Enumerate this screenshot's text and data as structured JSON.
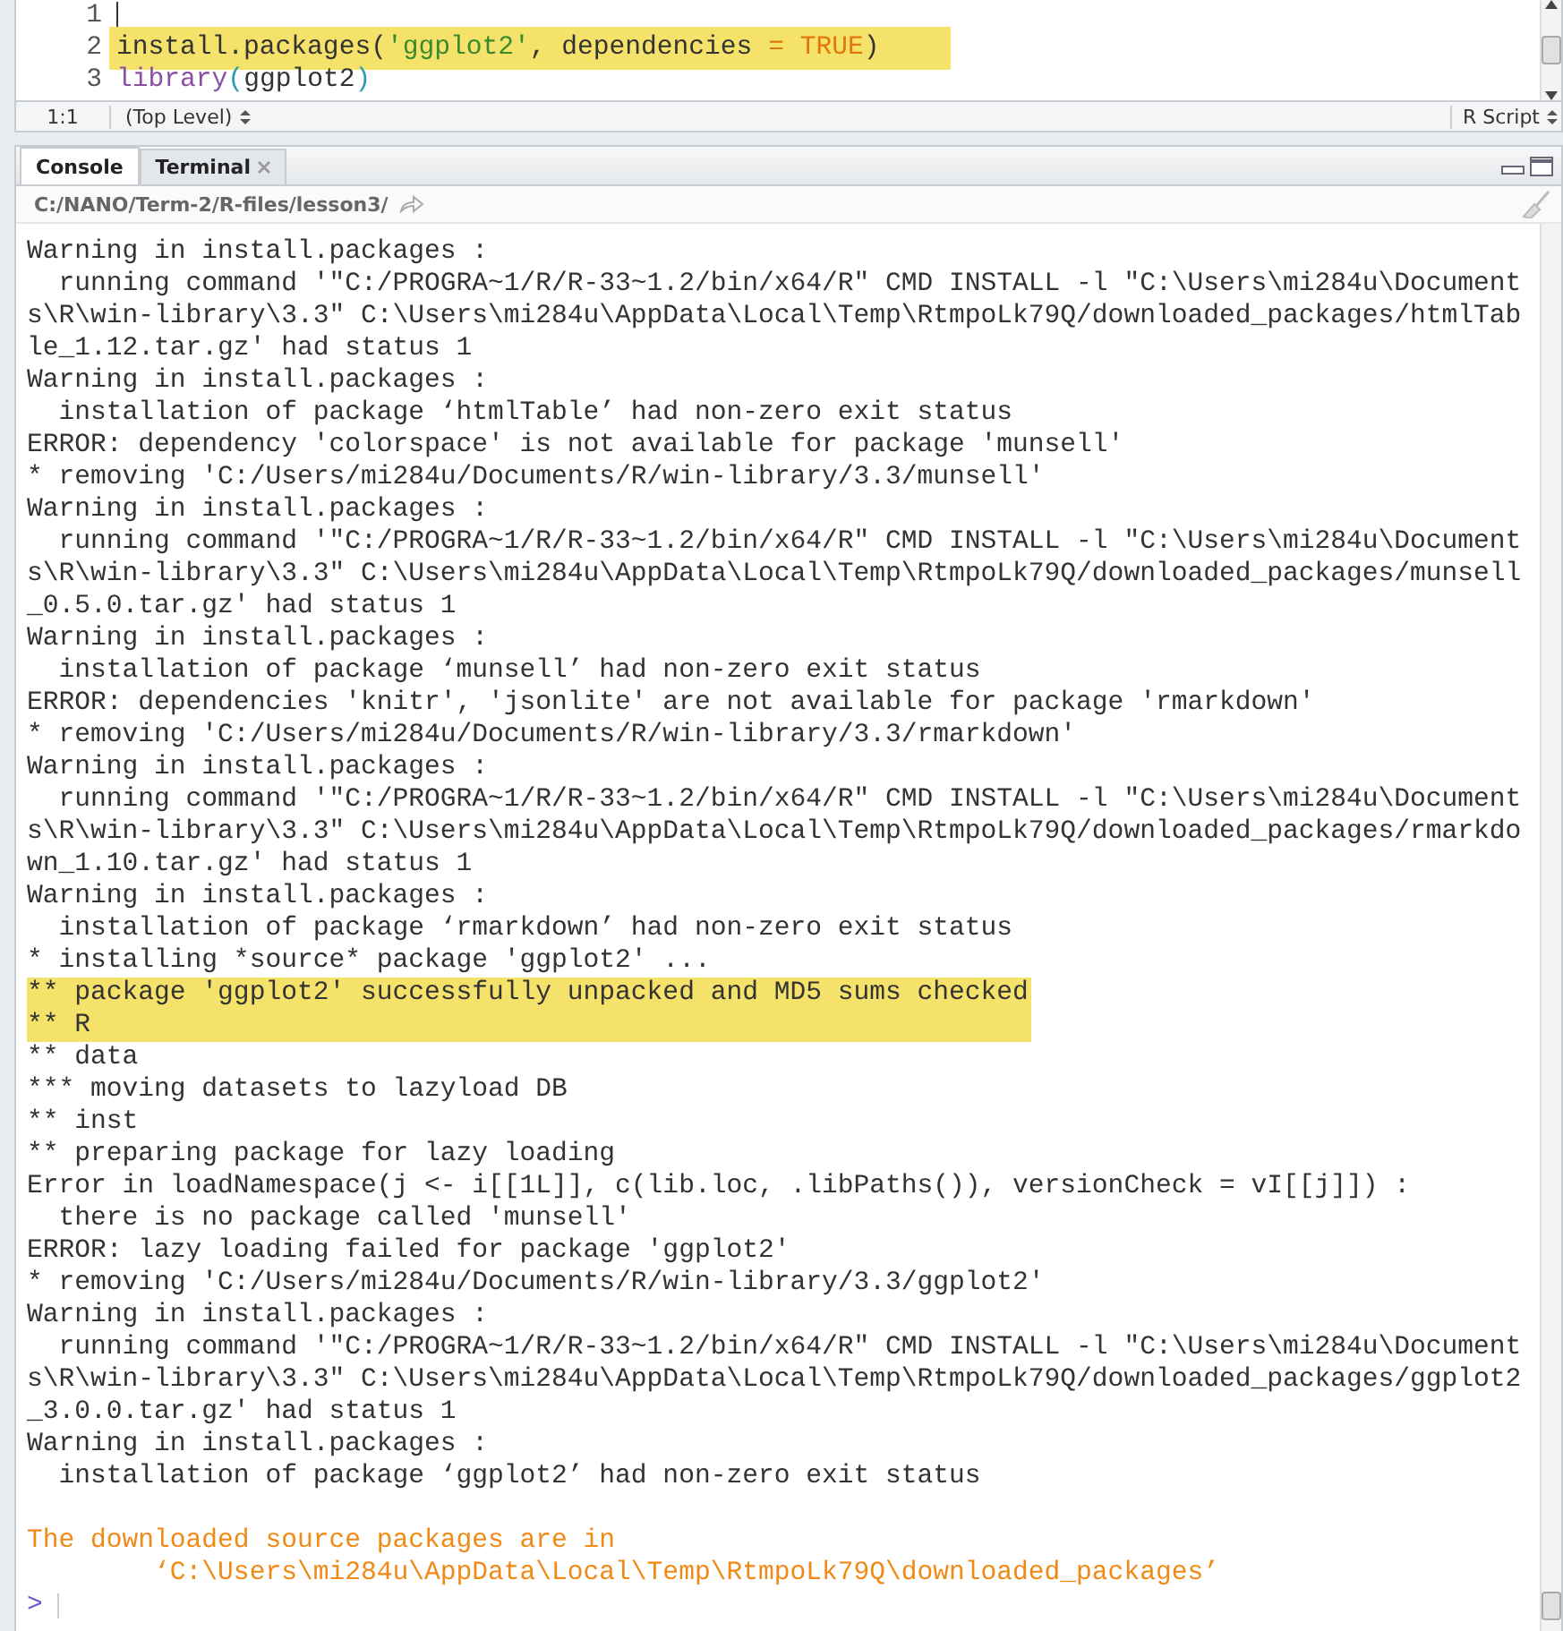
{
  "editor": {
    "lines": [
      {
        "number": "1",
        "highlighted": false,
        "cursor": true
      },
      {
        "number": "2",
        "highlighted": true,
        "cursor": false,
        "tokens": [
          {
            "kind": "plain",
            "text": "install.packages("
          },
          {
            "kind": "string",
            "text": "'ggplot2'"
          },
          {
            "kind": "plain",
            "text": ", dependencies "
          },
          {
            "kind": "operator",
            "text": "= "
          },
          {
            "kind": "constant",
            "text": "TRUE"
          },
          {
            "kind": "plain",
            "text": ")"
          }
        ]
      },
      {
        "number": "3",
        "highlighted": false,
        "cursor": false,
        "tokens": [
          {
            "kind": "function",
            "text": "library"
          },
          {
            "kind": "paren",
            "text": "("
          },
          {
            "kind": "plain",
            "text": "ggplot2"
          },
          {
            "kind": "paren",
            "text": ")"
          }
        ]
      }
    ]
  },
  "status_bar": {
    "position": "1:1",
    "scope": "(Top Level)",
    "file_type": "R Script"
  },
  "console_pane": {
    "tabs": [
      {
        "label": "Console",
        "selected": true,
        "closable": false
      },
      {
        "label": "Terminal",
        "selected": false,
        "closable": true
      }
    ],
    "path": "C:/NANO/Term-2/R-files/lesson3/",
    "lines": [
      {
        "kind": "output",
        "text": "Warning in install.packages :"
      },
      {
        "kind": "output",
        "text": "  running command '\"C:/PROGRA~1/R/R-33~1.2/bin/x64/R\" CMD INSTALL -l \"C:\\Users\\mi284u\\Document"
      },
      {
        "kind": "output",
        "text": "s\\R\\win-library\\3.3\" C:\\Users\\mi284u\\AppData\\Local\\Temp\\RtmpoLk79Q/downloaded_packages/htmlTab"
      },
      {
        "kind": "output",
        "text": "le_1.12.tar.gz' had status 1"
      },
      {
        "kind": "output",
        "text": "Warning in install.packages :"
      },
      {
        "kind": "output",
        "text": "  installation of package ‘htmlTable’ had non-zero exit status"
      },
      {
        "kind": "output",
        "text": "ERROR: dependency 'colorspace' is not available for package 'munsell'"
      },
      {
        "kind": "output",
        "text": "* removing 'C:/Users/mi284u/Documents/R/win-library/3.3/munsell'"
      },
      {
        "kind": "output",
        "text": "Warning in install.packages :"
      },
      {
        "kind": "output",
        "text": "  running command '\"C:/PROGRA~1/R/R-33~1.2/bin/x64/R\" CMD INSTALL -l \"C:\\Users\\mi284u\\Document"
      },
      {
        "kind": "output",
        "text": "s\\R\\win-library\\3.3\" C:\\Users\\mi284u\\AppData\\Local\\Temp\\RtmpoLk79Q/downloaded_packages/munsell"
      },
      {
        "kind": "output",
        "text": "_0.5.0.tar.gz' had status 1"
      },
      {
        "kind": "output",
        "text": "Warning in install.packages :"
      },
      {
        "kind": "output",
        "text": "  installation of package ‘munsell’ had non-zero exit status"
      },
      {
        "kind": "output",
        "text": "ERROR: dependencies 'knitr', 'jsonlite' are not available for package 'rmarkdown'"
      },
      {
        "kind": "output",
        "text": "* removing 'C:/Users/mi284u/Documents/R/win-library/3.3/rmarkdown'"
      },
      {
        "kind": "output",
        "text": "Warning in install.packages :"
      },
      {
        "kind": "output",
        "text": "  running command '\"C:/PROGRA~1/R/R-33~1.2/bin/x64/R\" CMD INSTALL -l \"C:\\Users\\mi284u\\Document"
      },
      {
        "kind": "output",
        "text": "s\\R\\win-library\\3.3\" C:\\Users\\mi284u\\AppData\\Local\\Temp\\RtmpoLk79Q/downloaded_packages/rmarkdo"
      },
      {
        "kind": "output",
        "text": "wn_1.10.tar.gz' had status 1"
      },
      {
        "kind": "output",
        "text": "Warning in install.packages :"
      },
      {
        "kind": "output",
        "text": "  installation of package ‘rmarkdown’ had non-zero exit status"
      },
      {
        "kind": "output",
        "text": "* installing *source* package 'ggplot2' ..."
      },
      {
        "kind": "highlight",
        "text": "** package 'ggplot2' successfully unpacked and MD5 sums checked"
      },
      {
        "kind": "highlight",
        "text": "** R"
      },
      {
        "kind": "output",
        "text": "** data"
      },
      {
        "kind": "output",
        "text": "*** moving datasets to lazyload DB"
      },
      {
        "kind": "output",
        "text": "** inst"
      },
      {
        "kind": "output",
        "text": "** preparing package for lazy loading"
      },
      {
        "kind": "output",
        "text": "Error in loadNamespace(j <- i[[1L]], c(lib.loc, .libPaths()), versionCheck = vI[[j]]) :"
      },
      {
        "kind": "output",
        "text": "  there is no package called 'munsell'"
      },
      {
        "kind": "output",
        "text": "ERROR: lazy loading failed for package 'ggplot2'"
      },
      {
        "kind": "output",
        "text": "* removing 'C:/Users/mi284u/Documents/R/win-library/3.3/ggplot2'"
      },
      {
        "kind": "output",
        "text": "Warning in install.packages :"
      },
      {
        "kind": "output",
        "text": "  running command '\"C:/PROGRA~1/R/R-33~1.2/bin/x64/R\" CMD INSTALL -l \"C:\\Users\\mi284u\\Document"
      },
      {
        "kind": "output",
        "text": "s\\R\\win-library\\3.3\" C:\\Users\\mi284u\\AppData\\Local\\Temp\\RtmpoLk79Q/downloaded_packages/ggplot2"
      },
      {
        "kind": "output",
        "text": "_3.0.0.tar.gz' had status 1"
      },
      {
        "kind": "output",
        "text": "Warning in install.packages :"
      },
      {
        "kind": "output",
        "text": "  installation of package ‘ggplot2’ had non-zero exit status"
      },
      {
        "kind": "blank"
      },
      {
        "kind": "message",
        "text": "The downloaded source packages are in"
      },
      {
        "kind": "message",
        "text": "        ‘C:\\Users\\mi284u\\AppData\\Local\\Temp\\RtmpoLk79Q\\downloaded_packages’"
      }
    ],
    "prompt": ">"
  }
}
